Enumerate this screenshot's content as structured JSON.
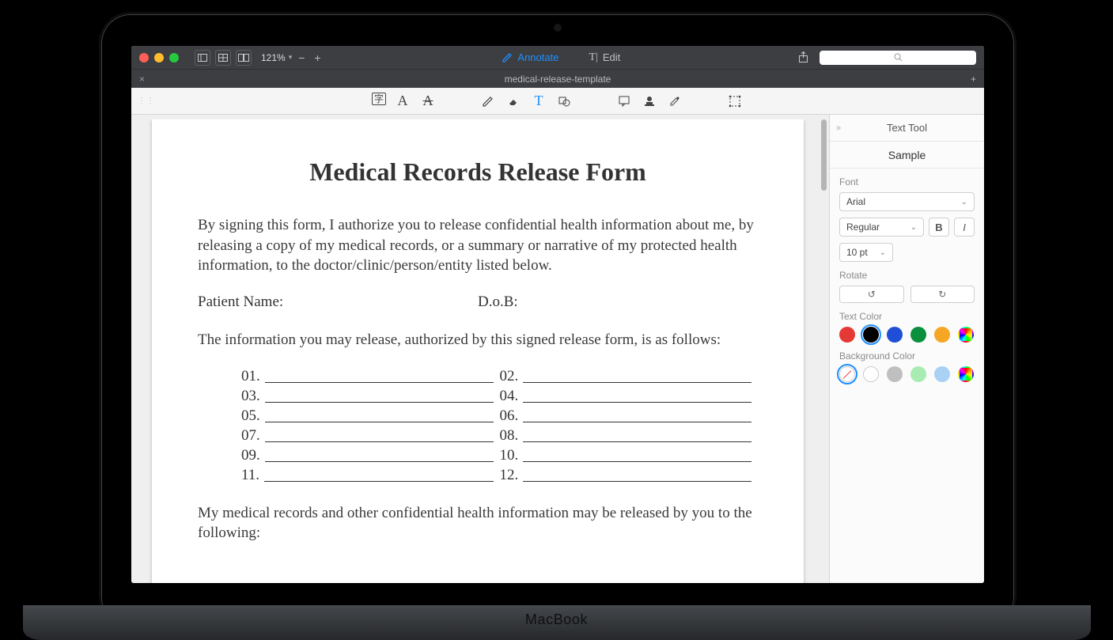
{
  "titlebar": {
    "zoom_value": "121%",
    "annotate_label": "Annotate",
    "edit_label": "Edit"
  },
  "tab": {
    "name": "medical-release-template"
  },
  "toolbar_icons": {
    "ocr": "text-recognition-icon",
    "style1": "text-style-a-icon",
    "style2": "text-style-a2-icon",
    "pencil": "pencil-icon",
    "eraser": "eraser-icon",
    "text": "text-tool-icon",
    "shape": "shape-icon",
    "note": "note-icon",
    "stamp": "stamp-icon",
    "dropper": "eyedropper-icon",
    "select": "selection-icon"
  },
  "document": {
    "title": "Medical Records Release Form",
    "intro": "By signing this form, I authorize you to release confidential health information about me, by releasing a copy of my medical records, or a summary or narrative of my protected health information, to the doctor/clinic/person/entity listed below.",
    "patient_name_label": "Patient Name:",
    "dob_label": "D.o.B:",
    "release_intro": "The information you may release, authorized by this signed release form, is as follows:",
    "numbered_pairs": [
      [
        "01.",
        "02."
      ],
      [
        "03.",
        "04."
      ],
      [
        "05.",
        "06."
      ],
      [
        "07.",
        "08."
      ],
      [
        "09.",
        "10."
      ],
      [
        "11.",
        "12."
      ]
    ],
    "release_to": "My medical records and other confidential health information may be released by you to the following:"
  },
  "inspector": {
    "panel_title": "Text Tool",
    "sample_label": "Sample",
    "font_label": "Font",
    "font_family": "Arial",
    "font_style": "Regular",
    "font_size": "10 pt",
    "bold_label": "B",
    "italic_label": "I",
    "rotate_label": "Rotate",
    "text_color_label": "Text Color",
    "bg_color_label": "Background Color",
    "text_colors": [
      "#e53935",
      "#000000",
      "#1e4fd6",
      "#0a8f3c",
      "#f5a623",
      "rainbow"
    ],
    "text_color_selected_index": 1,
    "bg_colors": [
      "none",
      "#ffffff",
      "#bfbfbf",
      "#a8ecb3",
      "#a9d1f3",
      "rainbow"
    ],
    "bg_color_selected_index": 0
  },
  "device_label": "MacBook"
}
